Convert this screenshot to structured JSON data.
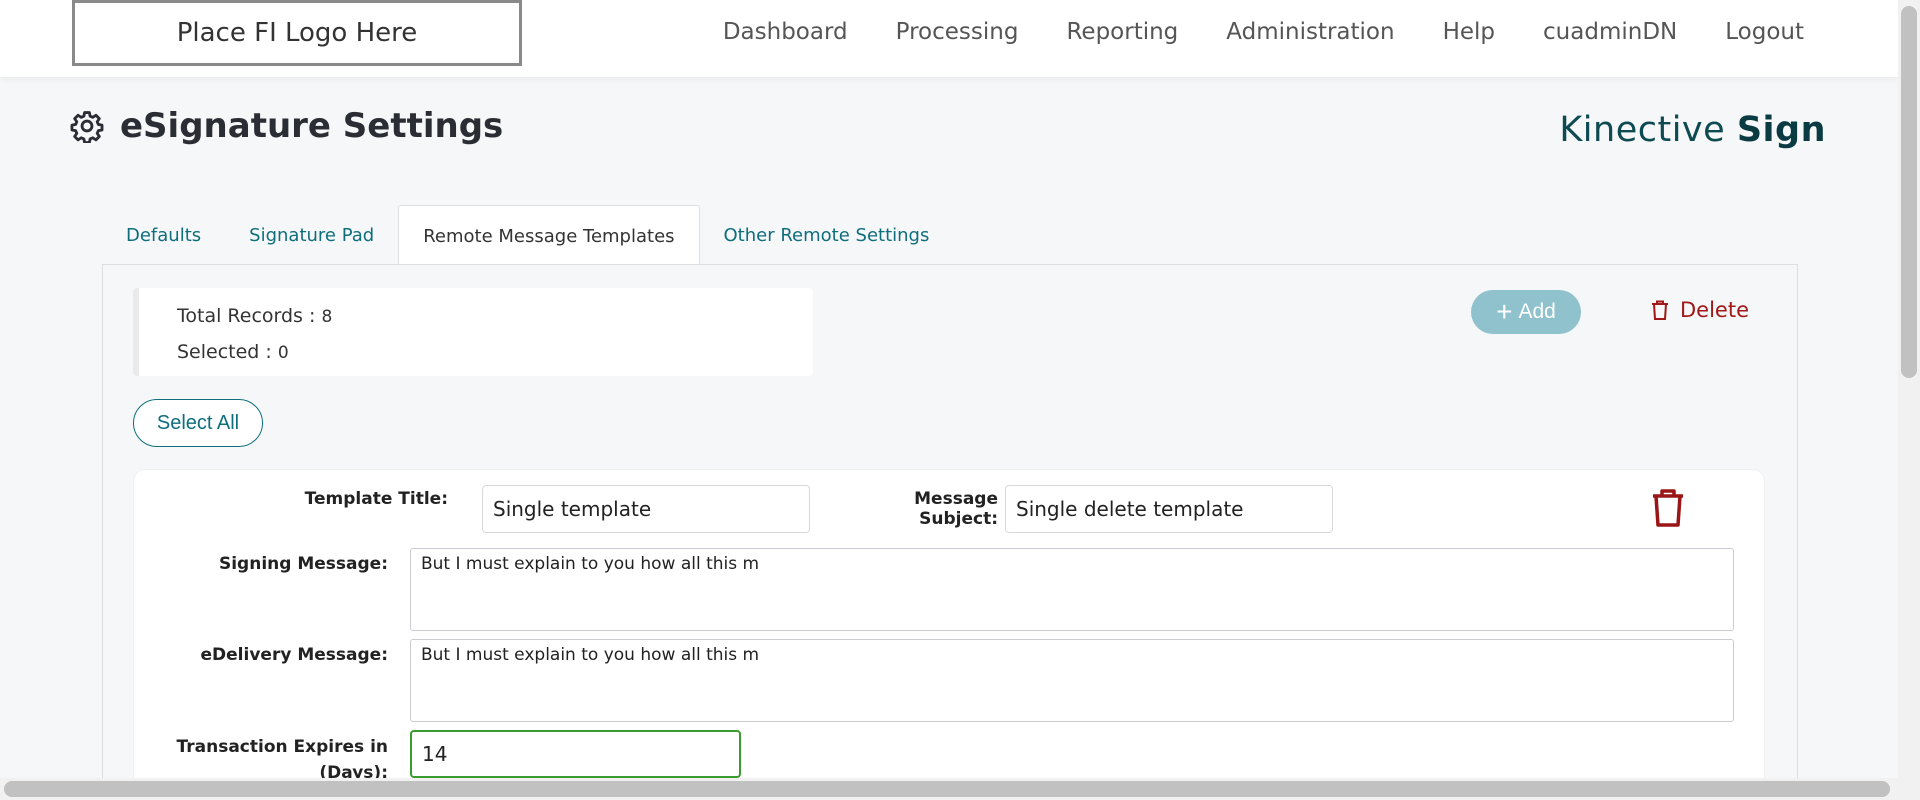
{
  "header": {
    "logo_text": "Place FI Logo Here",
    "nav": [
      "Dashboard",
      "Processing",
      "Reporting",
      "Administration",
      "Help",
      "cuadminDN",
      "Logout"
    ]
  },
  "page": {
    "title": "eSignature Settings",
    "brand_light": "Kinective ",
    "brand_bold": "Sign"
  },
  "tabs": [
    {
      "label": "Defaults",
      "active": false
    },
    {
      "label": "Signature Pad",
      "active": false
    },
    {
      "label": "Remote Message Templates",
      "active": true
    },
    {
      "label": "Other Remote Settings",
      "active": false
    }
  ],
  "records": {
    "total_label": "Total Records : ",
    "total_value": "8",
    "selected_label": "Selected : ",
    "selected_value": "0"
  },
  "actions": {
    "add_label": "Add",
    "delete_label": "Delete",
    "select_all_label": "Select All"
  },
  "template": {
    "title_label": "Template Title:",
    "title_value": "Single template",
    "subject_label": "Message Subject:",
    "subject_value": "Single delete template",
    "signing_label": "Signing Message:",
    "signing_value": "But I must explain to you how all this m",
    "edelivery_label": "eDelivery Message:",
    "edelivery_value": "But I must explain to you how all this m",
    "expires_label_line1": "Transaction Expires in",
    "expires_label_line2": "(Days):",
    "expires_value": "14"
  },
  "colors": {
    "accent": "#0e6e7c",
    "danger": "#a01818",
    "add_button": "#8fc2cc",
    "focus_border": "#3a9b2e"
  }
}
